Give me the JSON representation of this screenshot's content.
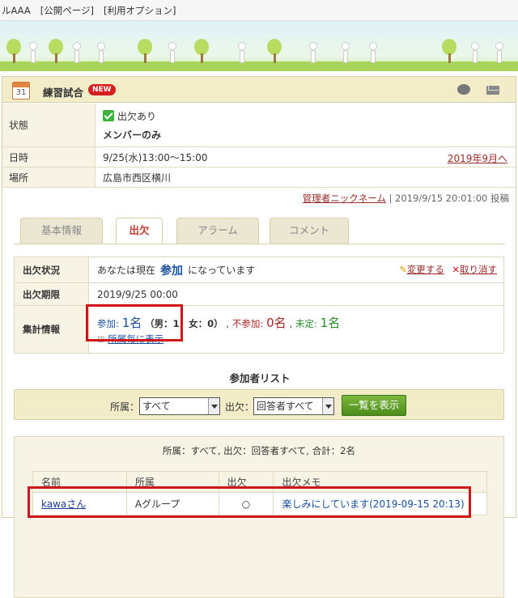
{
  "topnav": {
    "items": [
      "ルAAA",
      "[公開ページ]",
      "[利用オプション]"
    ]
  },
  "event": {
    "title": "練習試合",
    "badge": "NEW",
    "calendar_day": "31",
    "rows": [
      {
        "label": "状態",
        "line1": "出欠あり",
        "line2": "メンバーのみ"
      },
      {
        "label": "日時",
        "value": "9/25(水)13:00～15:00",
        "link": "2019年9月へ"
      },
      {
        "label": "場所",
        "value": "広島市西区横川"
      }
    ],
    "poster_link": "管理者ニックネーム",
    "poster_meta": " | 2019/9/15 20:01:00 投稿"
  },
  "tabs": [
    {
      "label": "基本情報",
      "active": false
    },
    {
      "label": "出欠",
      "active": true
    },
    {
      "label": "アラーム",
      "active": false
    },
    {
      "label": "コメント",
      "active": false
    }
  ],
  "attendance": {
    "status_label": "出欠状況",
    "status_pre": "あなたは現在",
    "status_value": "参加",
    "status_post": "になっています",
    "change_label": "変更する",
    "cancel_label": "取り消す",
    "deadline_label": "出欠期限",
    "deadline_value": "2019/9/25 00:00",
    "summary_label": "集計情報",
    "join_label": "参加:",
    "join_value": "1名",
    "gender": "（男：1　女：0）",
    "absent_label": "不参加:",
    "absent_value": "0名",
    "undecided_label": "未定:",
    "undecided_value": "1名",
    "by_group_link": "所属毎に表示"
  },
  "participants": {
    "title": "参加者リスト",
    "filter_group_label": "所属：",
    "filter_group_value": "すべて",
    "filter_att_label": "出欠：",
    "filter_att_value": "回答者すべて",
    "show_button": "一覧を表示",
    "summary": "所属：すべて, 出欠：回答者すべて, 合計：2名",
    "columns": [
      "名前",
      "所属",
      "出欠",
      "出欠メモ"
    ],
    "rows": [
      {
        "name": "kawaさん",
        "group": "Aグループ",
        "attendance": "○",
        "memo": "楽しみにしています(2019-09-15 20:13)"
      }
    ]
  }
}
